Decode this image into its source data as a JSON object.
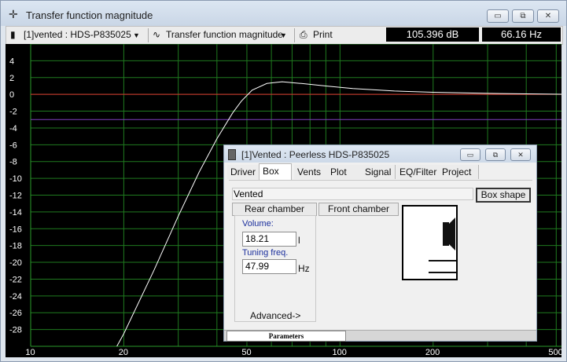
{
  "window": {
    "title": "Transfer function magnitude",
    "minimize": "▭",
    "restore": "⧉",
    "close": "✕"
  },
  "toolbar": {
    "speaker_selector": "[1]vented : HDS-P835025",
    "view_selector": "Transfer function magnitude",
    "print_label": "Print",
    "readout_db": "105.396 dB",
    "readout_hz": "66.16 Hz"
  },
  "chart_data": {
    "type": "line",
    "x_scale": "log",
    "xlim": [
      10,
      520
    ],
    "ylim": [
      -30,
      6
    ],
    "x_ticks": [
      "10",
      "20",
      "50",
      "100",
      "200",
      "500"
    ],
    "y_ticks": [
      "4",
      "2",
      "0",
      "-2",
      "-4",
      "-6",
      "-8",
      "-10",
      "-12",
      "-14",
      "-16",
      "-18",
      "-20",
      "-22",
      "-24",
      "-26",
      "-28"
    ],
    "grid": true,
    "reference_lines": [
      {
        "y": 0,
        "color": "#e03030"
      },
      {
        "y": -3,
        "color": "#8040c0"
      }
    ],
    "series": [
      {
        "color": "#ffffff",
        "x": [
          19,
          20,
          25,
          30,
          35,
          40,
          45,
          48,
          52,
          58,
          65,
          75,
          90,
          110,
          150,
          200,
          300,
          400,
          520
        ],
        "y": [
          -30,
          -28.5,
          -21,
          -14.5,
          -9.3,
          -5.3,
          -2.2,
          -0.8,
          0.5,
          1.3,
          1.5,
          1.3,
          1.0,
          0.7,
          0.4,
          0.25,
          0.12,
          0.06,
          0.02
        ]
      }
    ]
  },
  "dialog": {
    "title": "[1]Vented : Peerless HDS-P835025",
    "tabs": [
      "Driver",
      "Box",
      "Vents",
      "Plot",
      "Signal",
      "EQ/Filter",
      "Project"
    ],
    "active_tab": "Box",
    "box_type": "Vented",
    "box_shape_button": "Box shape",
    "rear_chamber_button": "Rear chamber",
    "front_chamber_button": "Front chamber",
    "volume_label": "Volume:",
    "volume_value": "18.21",
    "volume_unit": "l",
    "tuning_label": "Tuning freq.",
    "tuning_value": "47.99",
    "tuning_unit": "Hz",
    "advanced_label": "Advanced->",
    "status_tab": "Parameters"
  }
}
